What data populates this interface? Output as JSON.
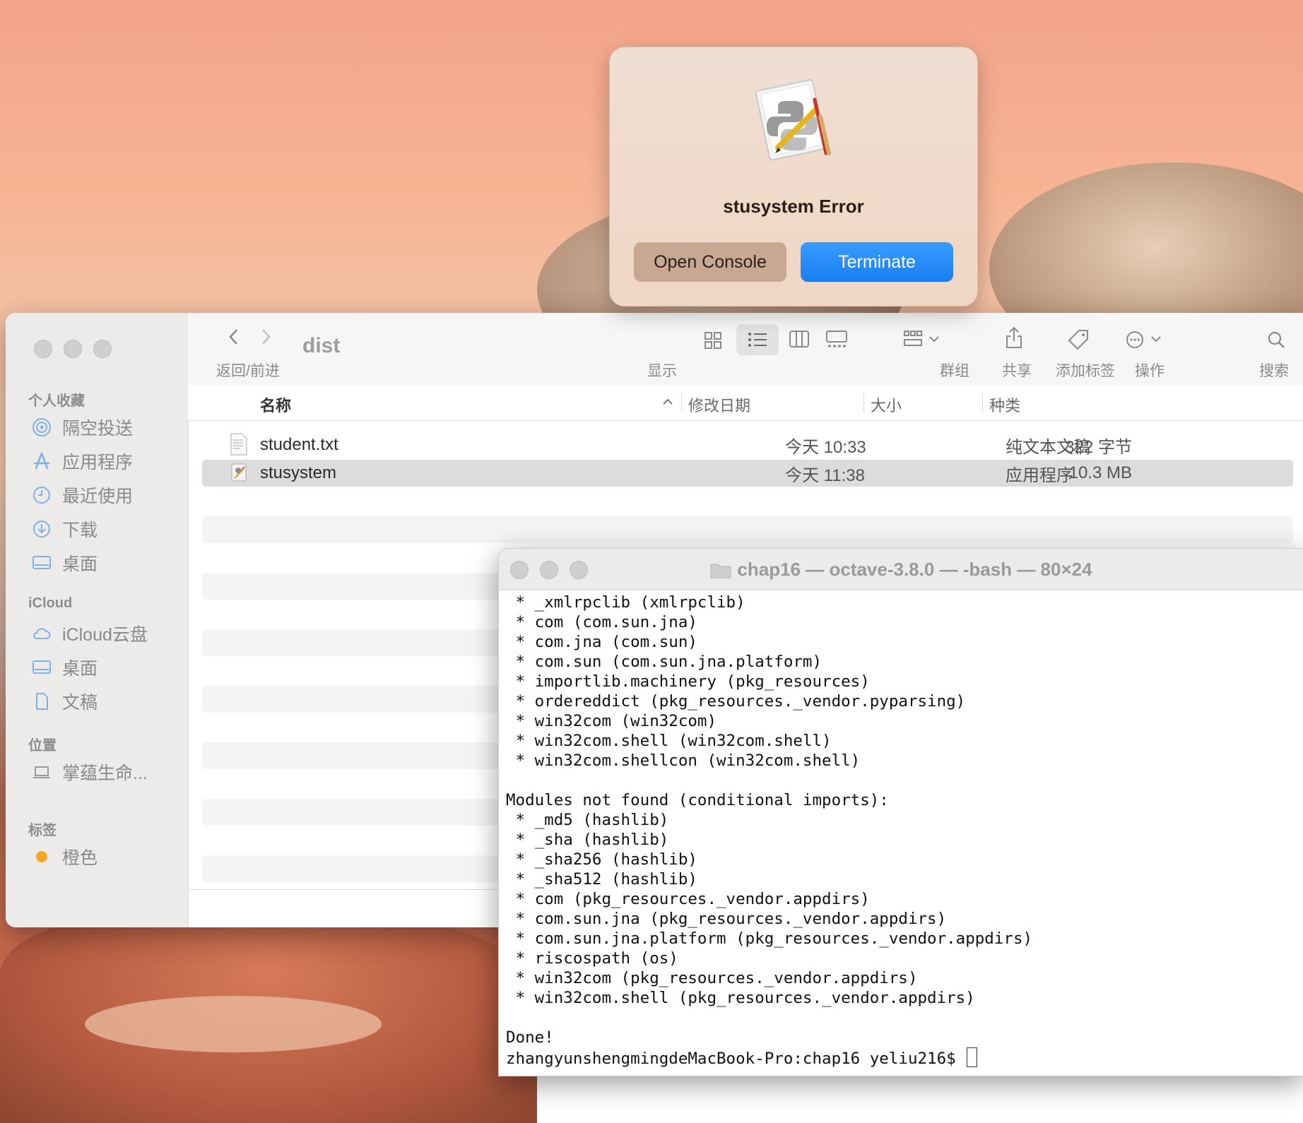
{
  "dialog": {
    "title": "stusystem Error",
    "open_console_label": "Open Console",
    "terminate_label": "Terminate"
  },
  "finder": {
    "window_title": "dist",
    "toolbar": {
      "back_forward_label": "返回/前进",
      "view_label": "显示",
      "group_label": "群组",
      "share_label": "共享",
      "tags_label": "添加标签",
      "action_label": "操作",
      "search_label": "搜索"
    },
    "sidebar": {
      "favorites_header": "个人收藏",
      "favorites": [
        {
          "label": "隔空投送",
          "icon": "airdrop-icon"
        },
        {
          "label": "应用程序",
          "icon": "applications-icon"
        },
        {
          "label": "最近使用",
          "icon": "clock-icon"
        },
        {
          "label": "下载",
          "icon": "download-icon"
        },
        {
          "label": "桌面",
          "icon": "desktop-icon"
        }
      ],
      "icloud_header": "iCloud",
      "icloud": [
        {
          "label": "iCloud云盘",
          "icon": "cloud-icon"
        },
        {
          "label": "桌面",
          "icon": "desktop-icon"
        },
        {
          "label": "文稿",
          "icon": "document-icon"
        }
      ],
      "locations_header": "位置",
      "locations": [
        {
          "label": "掌蕴生命...",
          "icon": "laptop-icon"
        }
      ],
      "tags_header": "标签",
      "tags": [
        {
          "label": "橙色",
          "color": "#f5a623"
        }
      ]
    },
    "columns": {
      "name": "名称",
      "modified": "修改日期",
      "size": "大小",
      "kind": "种类"
    },
    "files": [
      {
        "name": "student.txt",
        "modified": "今天 10:33",
        "size": "322 字节",
        "kind": "纯文本文稿",
        "selected": false
      },
      {
        "name": "stusystem",
        "modified": "今天 11:38",
        "size": "10.3 MB",
        "kind": "应用程序",
        "selected": true
      }
    ]
  },
  "terminal": {
    "title": "chap16 — octave-3.8.0 — -bash — 80×24",
    "lines": [
      " * _xmlrpclib (xmlrpclib)",
      " * com (com.sun.jna)",
      " * com.jna (com.sun)",
      " * com.sun (com.sun.jna.platform)",
      " * importlib.machinery (pkg_resources)",
      " * ordereddict (pkg_resources._vendor.pyparsing)",
      " * win32com (win32com)",
      " * win32com.shell (win32com.shell)",
      " * win32com.shellcon (win32com.shell)",
      "",
      "Modules not found (conditional imports):",
      " * _md5 (hashlib)",
      " * _sha (hashlib)",
      " * _sha256 (hashlib)",
      " * _sha512 (hashlib)",
      " * com (pkg_resources._vendor.appdirs)",
      " * com.sun.jna (pkg_resources._vendor.appdirs)",
      " * com.sun.jna.platform (pkg_resources._vendor.appdirs)",
      " * riscospath (os)",
      " * win32com (pkg_resources._vendor.appdirs)",
      " * win32com.shell (pkg_resources._vendor.appdirs)",
      "",
      "Done!"
    ],
    "prompt": "zhangyunshengmingdeMacBook-Pro:chap16 yeliu216$ "
  }
}
